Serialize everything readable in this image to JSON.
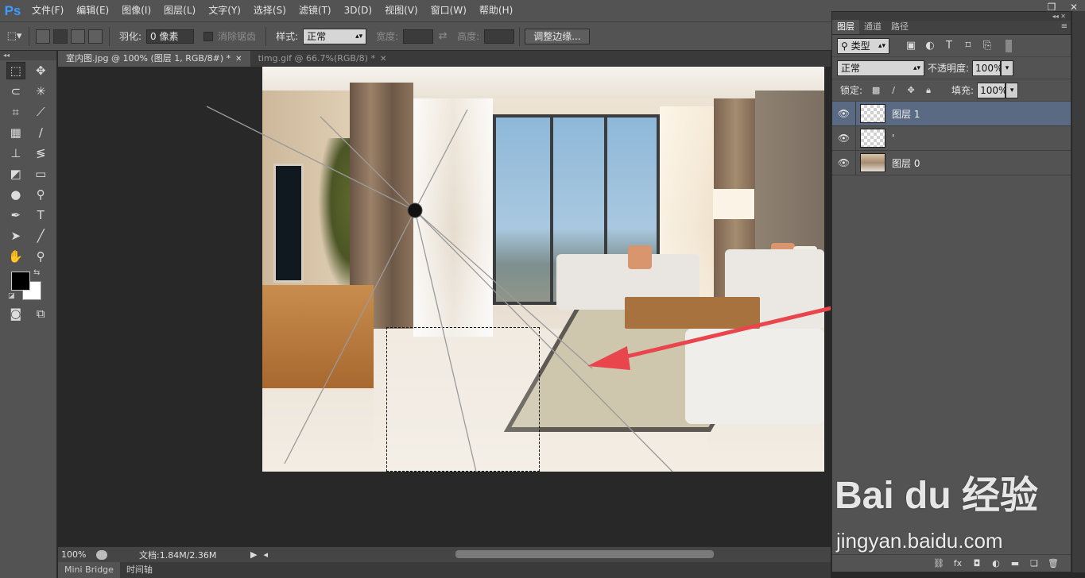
{
  "app": {
    "logo": "Ps"
  },
  "menu": [
    "文件(F)",
    "编辑(E)",
    "图像(I)",
    "图层(L)",
    "文字(Y)",
    "选择(S)",
    "滤镜(T)",
    "3D(D)",
    "视图(V)",
    "窗口(W)",
    "帮助(H)"
  ],
  "options": {
    "feather_label": "羽化:",
    "feather_value": "0 像素",
    "antialias_label": "消除锯齿",
    "style_label": "样式:",
    "style_value": "正常",
    "width_label": "宽度:",
    "height_label": "高度:",
    "refine_edge_button": "调整边缘..."
  },
  "tabs": [
    {
      "label": "室内图.jpg @ 100% (图层 1, RGB/8#) *",
      "active": true
    },
    {
      "label": "timg.gif @ 66.7%(RGB/8) *",
      "active": false
    }
  ],
  "status": {
    "zoom": "100%",
    "doc_info": "文档:1.84M/2.36M"
  },
  "bottom_tabs": [
    "Mini Bridge",
    "时间轴"
  ],
  "layers_panel": {
    "tabs": [
      "图层",
      "通道",
      "路径"
    ],
    "filter_kind": "类型",
    "blend_mode": "正常",
    "opacity_label": "不透明度:",
    "opacity_value": "100%",
    "lock_label": "锁定:",
    "fill_label": "填充:",
    "fill_value": "100%",
    "layers": [
      {
        "name": "图层 1",
        "selected": true,
        "thumb": "transparent"
      },
      {
        "name": "'",
        "selected": false,
        "thumb": "transparent"
      },
      {
        "name": "图层 0",
        "selected": false,
        "thumb": "photo"
      }
    ],
    "footer_icons": [
      "link-icon",
      "fx-icon",
      "mask-icon",
      "adjustment-icon",
      "folder-icon",
      "new-layer-icon",
      "trash-icon"
    ]
  },
  "watermark": {
    "logo": "Bai du 经验",
    "url": "jingyan.baidu.com"
  },
  "colors": {
    "foreground": "#000000",
    "background": "#ffffff",
    "accent_arrow": "#e8454c",
    "selection": "#5a6a82"
  }
}
